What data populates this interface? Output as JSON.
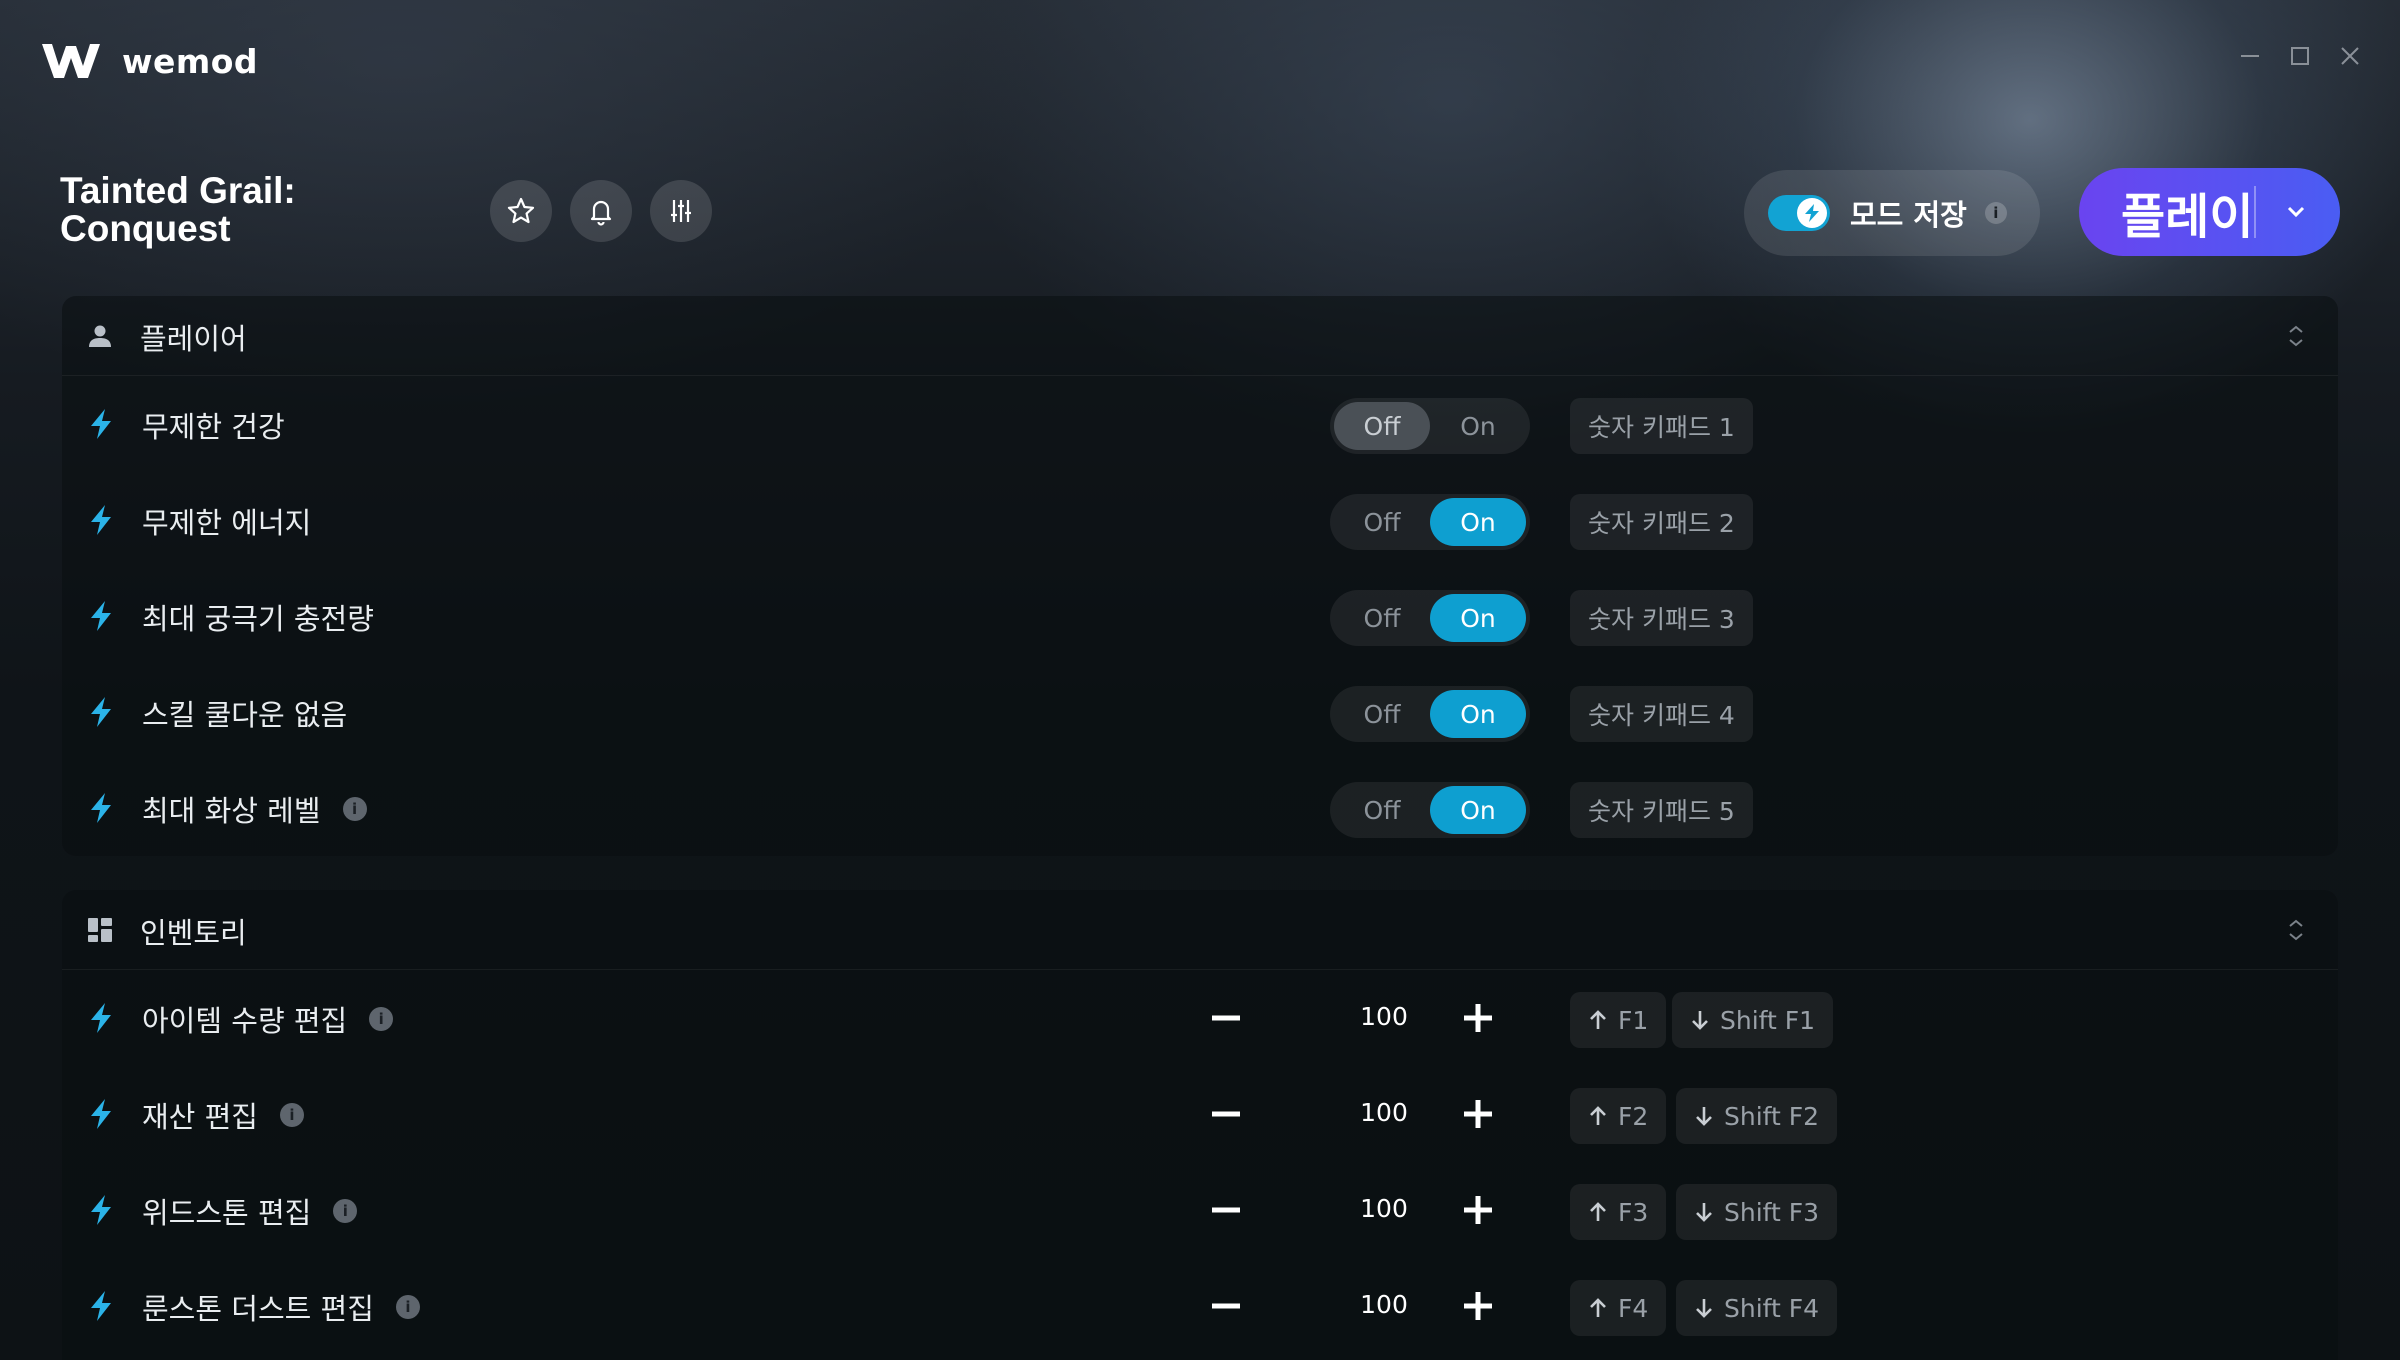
{
  "app": {
    "name": "wemod"
  },
  "game": {
    "title_line1": "Tainted Grail:",
    "title_line2": "Conquest"
  },
  "header": {
    "save_mods_label": "모드 저장",
    "save_mods_info": "i",
    "play_label": "플레이"
  },
  "colors": {
    "accent": "#0e9fd0",
    "play_gradient_start": "#6a44f0",
    "play_gradient_end": "#4a5df3",
    "bolt": "#2bb3e8"
  },
  "toggle_labels": {
    "off": "Off",
    "on": "On"
  },
  "player": {
    "title": "플레이어",
    "mods": [
      {
        "label": "무제한 건강",
        "state": "off",
        "hotkey": "숫자 키패드 1"
      },
      {
        "label": "무제한 에너지",
        "state": "on",
        "hotkey": "숫자 키패드 2"
      },
      {
        "label": "최대 궁극기 충전량",
        "state": "on",
        "hotkey": "숫자 키패드 3"
      },
      {
        "label": "스킬 쿨다운 없음",
        "state": "on",
        "hotkey": "숫자 키패드 4"
      },
      {
        "label": "최대 화상 레벨",
        "state": "on",
        "hotkey": "숫자 키패드 5",
        "info": true
      }
    ]
  },
  "inventory": {
    "title": "인벤토리",
    "mods": [
      {
        "label": "아이템 수량 편집",
        "value": "100",
        "up_key": "F1",
        "down_key": "Shift F1",
        "info": true
      },
      {
        "label": "재산 편집",
        "value": "100",
        "up_key": "F2",
        "down_key": "Shift F2",
        "info": true
      },
      {
        "label": "위드스톤 편집",
        "value": "100",
        "up_key": "F3",
        "down_key": "Shift F3",
        "info": true
      },
      {
        "label": "룬스톤 더스트 편집",
        "value": "100",
        "up_key": "F4",
        "down_key": "Shift F4",
        "info": true
      }
    ]
  }
}
